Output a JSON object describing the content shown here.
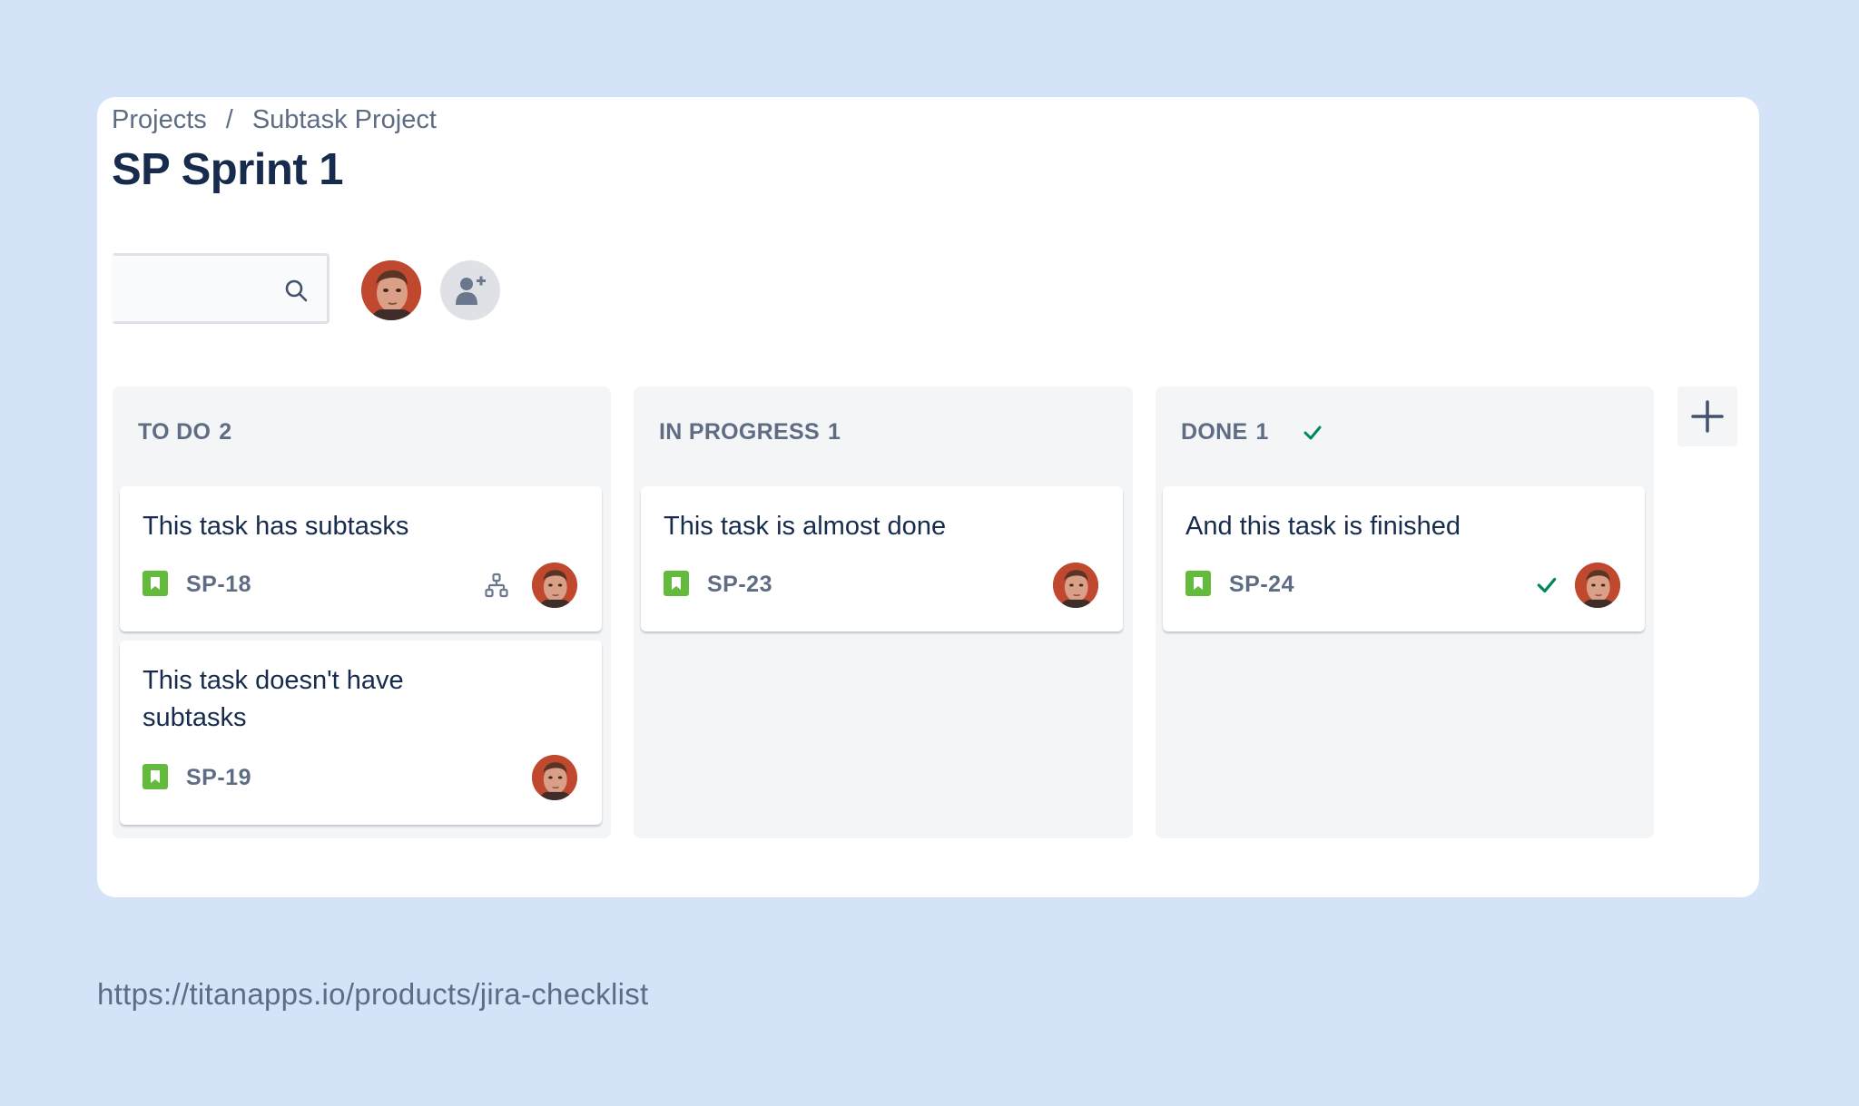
{
  "breadcrumb": {
    "items": [
      "Projects",
      "Subtask Project"
    ],
    "separator": "/"
  },
  "page": {
    "title": "SP Sprint 1"
  },
  "search": {
    "placeholder": "",
    "value": "",
    "icon": "search-icon"
  },
  "toolbar": {
    "add_people_icon": "add-user-icon"
  },
  "columns": [
    {
      "name": "TO DO",
      "count": "2",
      "cards": [
        {
          "title": "This task has subtasks",
          "key": "SP-18",
          "has_subtasks": true
        },
        {
          "title": "This task doesn't have subtasks",
          "key": "SP-19"
        }
      ]
    },
    {
      "name": "IN PROGRESS",
      "count": "1",
      "cards": [
        {
          "title": "This task is almost done",
          "key": "SP-23"
        }
      ]
    },
    {
      "name": "DONE",
      "count": "1",
      "cards": [
        {
          "title": "And this task is finished",
          "key": "SP-24",
          "done": true
        }
      ]
    }
  ],
  "footer": {
    "url": "https://titanapps.io/products/jira-checklist"
  },
  "colors": {
    "background": "#d5e3f8",
    "story_green": "#63ba3c",
    "done_green": "#00875a",
    "text_primary": "#172b4d",
    "text_secondary": "#5e6c84"
  }
}
